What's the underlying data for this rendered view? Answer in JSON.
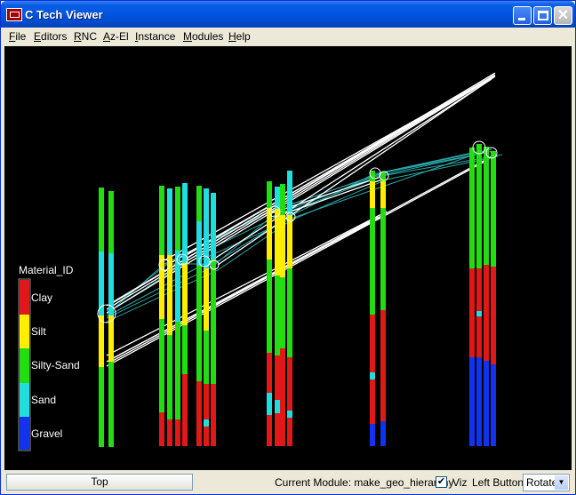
{
  "window": {
    "title": "C Tech Viewer"
  },
  "menu": [
    {
      "mnemonic": "F",
      "rest": "ile"
    },
    {
      "mnemonic": "E",
      "rest": "ditors"
    },
    {
      "mnemonic": "R",
      "rest": "NC"
    },
    {
      "mnemonic": "A",
      "rest": "z-El"
    },
    {
      "mnemonic": "I",
      "rest": "nstance"
    },
    {
      "mnemonic": "M",
      "rest": "odules"
    },
    {
      "mnemonic": "H",
      "rest": "elp"
    }
  ],
  "legend": {
    "title": "Material_ID",
    "entries": [
      {
        "label": "Clay",
        "color": "#e01818"
      },
      {
        "label": "Silt",
        "color": "#ffee00"
      },
      {
        "label": "Silty-Sand",
        "color": "#22dd11"
      },
      {
        "label": "Sand",
        "color": "#22dddd"
      },
      {
        "label": "Gravel",
        "color": "#1133ee"
      }
    ]
  },
  "colors": {
    "connector_white": "#ffffff",
    "connector_teal": "#2aa6a6"
  },
  "status": {
    "view_button": "Top",
    "current_module": "Current Module: make_geo_hierarchy",
    "viz_checked": "✔",
    "viz_label": "Viz",
    "left_button_label": "Left Button",
    "mode_value": "Rotate",
    "mode_arrow": "▼"
  }
}
